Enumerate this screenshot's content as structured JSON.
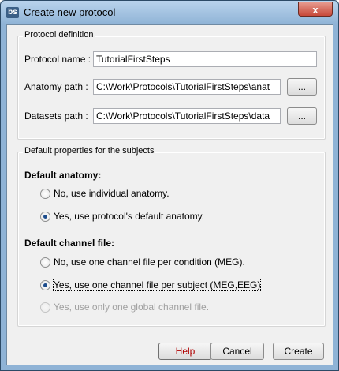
{
  "window": {
    "title": "Create new protocol",
    "app_icon": "bs",
    "close_label": "x"
  },
  "protocol": {
    "legend": "Protocol definition",
    "name_label": "Protocol name :",
    "name_value": "TutorialFirstSteps",
    "anatomy_label": "Anatomy path :",
    "anatomy_value": "C:\\Work\\Protocols\\TutorialFirstSteps\\anat",
    "datasets_label": "Datasets path :",
    "datasets_value": "C:\\Work\\Protocols\\TutorialFirstSteps\\data",
    "browse_label": "..."
  },
  "defaults": {
    "legend": "Default properties for the subjects",
    "anatomy_heading": "Default anatomy:",
    "anatomy_options": [
      {
        "label": "No, use individual anatomy.",
        "selected": false,
        "enabled": true
      },
      {
        "label": "Yes, use protocol's default anatomy.",
        "selected": true,
        "enabled": true
      }
    ],
    "channel_heading": "Default channel file:",
    "channel_options": [
      {
        "label": "No, use one channel file per condition (MEG).",
        "selected": false,
        "enabled": true
      },
      {
        "label": "Yes, use one channel file per subject (MEG,EEG)",
        "selected": true,
        "enabled": true
      },
      {
        "label": "Yes, use only one global channel file.",
        "selected": false,
        "enabled": false
      }
    ]
  },
  "buttons": {
    "help": "Help",
    "cancel": "Cancel",
    "create": "Create"
  },
  "colors": {
    "frame": "#8fb3d6",
    "client": "#f0f0f0",
    "close": "#c7493a",
    "help_text": "#b00000"
  }
}
